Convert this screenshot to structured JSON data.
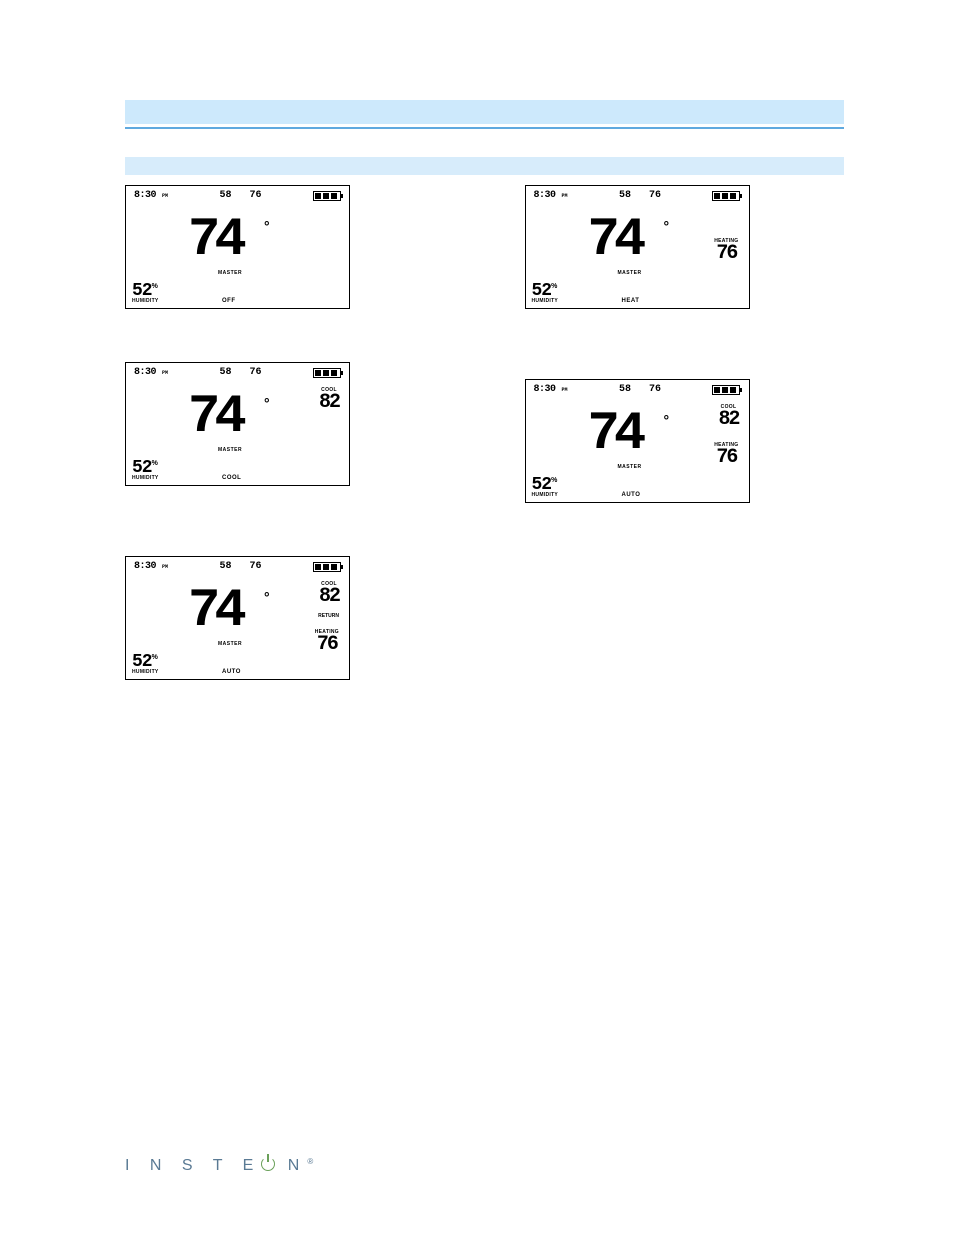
{
  "brand": "I N S T E",
  "registered": "®",
  "lcd_common": {
    "time": "8:30",
    "ampm_label": "PM",
    "sp1": "58",
    "sp2": "76",
    "temp": "74",
    "degree": "°",
    "master_label": "MASTER",
    "humidity": "52",
    "humidity_pct": "%",
    "humidity_label": "HUMIDITY"
  },
  "modes": {
    "off": "OFF",
    "heat": "HEAT",
    "cool": "COOL",
    "auto": "AUTO"
  },
  "side": {
    "cool_label": "COOL",
    "cool_val": "82",
    "heating_label": "HEATING",
    "heating_val": "76",
    "return_label": "RETURN"
  }
}
